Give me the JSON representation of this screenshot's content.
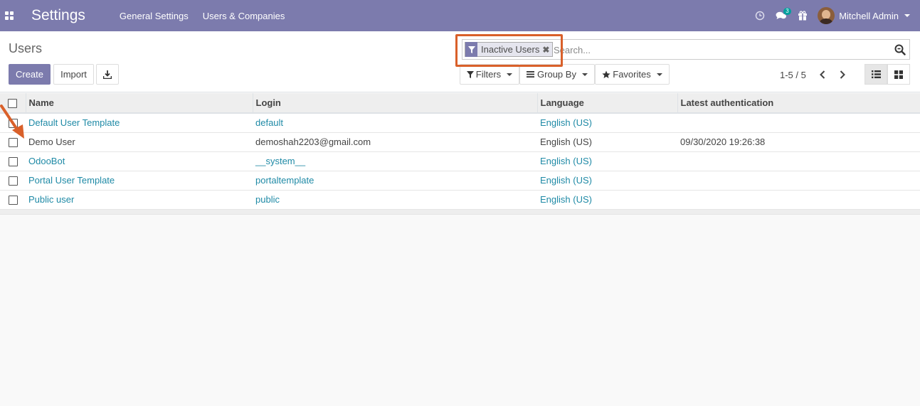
{
  "navbar": {
    "app_title": "Settings",
    "menu": [
      "General Settings",
      "Users & Companies"
    ],
    "messages_badge": "3",
    "user_name": "Mitchell Admin"
  },
  "control_panel": {
    "breadcrumb": "Users",
    "facet_label": "Inactive Users",
    "search_placeholder": "Search...",
    "create_label": "Create",
    "import_label": "Import",
    "filters_label": "Filters",
    "group_by_label": "Group By",
    "favorites_label": "Favorites",
    "pager": "1-5 / 5"
  },
  "table": {
    "headers": [
      "Name",
      "Login",
      "Language",
      "Latest authentication"
    ],
    "rows": [
      {
        "name": "Default User Template",
        "login": "default",
        "language": "English (US)",
        "latest_auth": ""
      },
      {
        "name": "Demo User",
        "login": "demoshah2203@gmail.com",
        "language": "English (US)",
        "latest_auth": "09/30/2020 19:26:38"
      },
      {
        "name": "OdooBot",
        "login": "__system__",
        "language": "English (US)",
        "latest_auth": ""
      },
      {
        "name": "Portal User Template",
        "login": "portaltemplate",
        "language": "English (US)",
        "latest_auth": ""
      },
      {
        "name": "Public user",
        "login": "public",
        "language": "English (US)",
        "latest_auth": ""
      }
    ]
  },
  "colors": {
    "brand": "#7c7bad",
    "link": "#1f8aa6",
    "annotation": "#d9602a"
  }
}
